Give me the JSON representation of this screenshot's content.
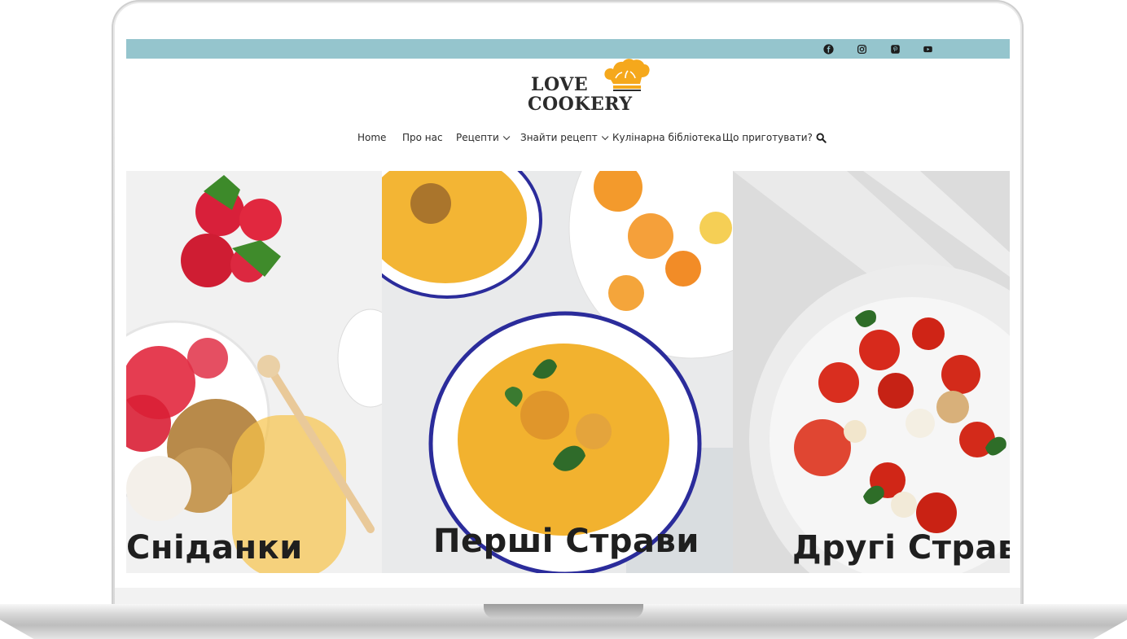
{
  "social": [
    {
      "name": "facebook-icon"
    },
    {
      "name": "instagram-icon"
    },
    {
      "name": "pinterest-icon"
    },
    {
      "name": "youtube-icon"
    }
  ],
  "logo": {
    "line1": "LOVE",
    "line2": "COOKERY"
  },
  "nav": {
    "items": [
      {
        "label": "Home"
      },
      {
        "label": "Про нас"
      },
      {
        "label": "Рецепти",
        "dropdown": true
      },
      {
        "label": "Знайти рецепт",
        "dropdown": true
      },
      {
        "label": "Кулінарна бібліотека"
      },
      {
        "label": "Що приготувати?"
      }
    ],
    "search_icon": "search-icon"
  },
  "categories": [
    {
      "title": "Сніданки"
    },
    {
      "title": "Перші Страви"
    },
    {
      "title": "Другі Страви"
    }
  ],
  "colors": {
    "topbar": "#95c5cd",
    "logo_accent": "#f5a81c",
    "text": "#2b2b2b"
  }
}
